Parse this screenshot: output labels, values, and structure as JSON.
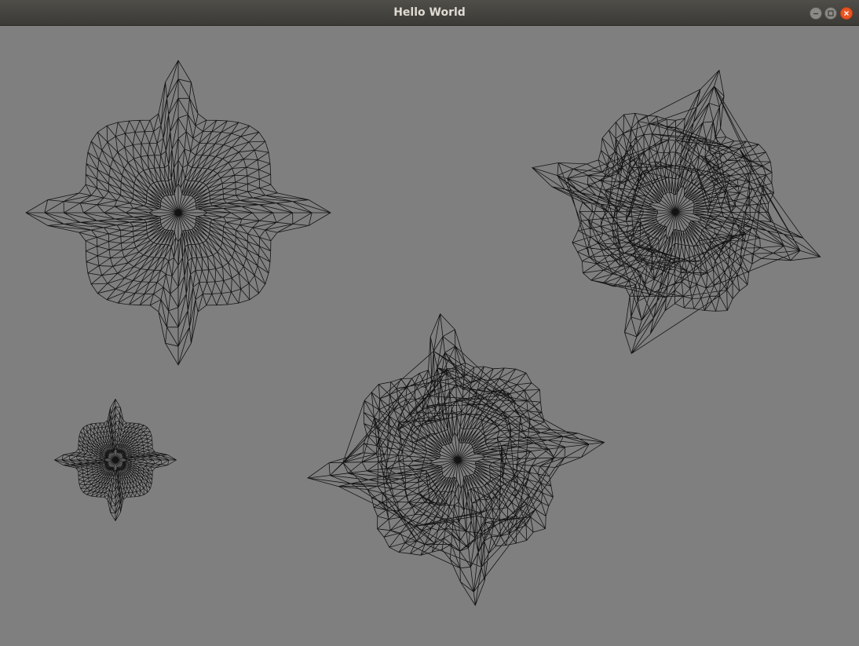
{
  "window": {
    "title": "Hello World",
    "controls": {
      "minimize_icon": "minimize-icon",
      "maximize_icon": "maximize-icon",
      "close_icon": "close-icon"
    }
  },
  "colors": {
    "background": "#7f7f7f",
    "wire": "#000000",
    "titlebar": "#3f3e3a",
    "close": "#e95420"
  },
  "scene": {
    "render_mode": "wireframe",
    "meshes": [
      {
        "name": "blob-large-top-left",
        "arms": 4
      },
      {
        "name": "blob-tilted-top-right",
        "arms": 4
      },
      {
        "name": "blob-small-bottom-left",
        "arms": 4
      },
      {
        "name": "blob-tilted-bottom-center",
        "arms": 4
      }
    ]
  }
}
